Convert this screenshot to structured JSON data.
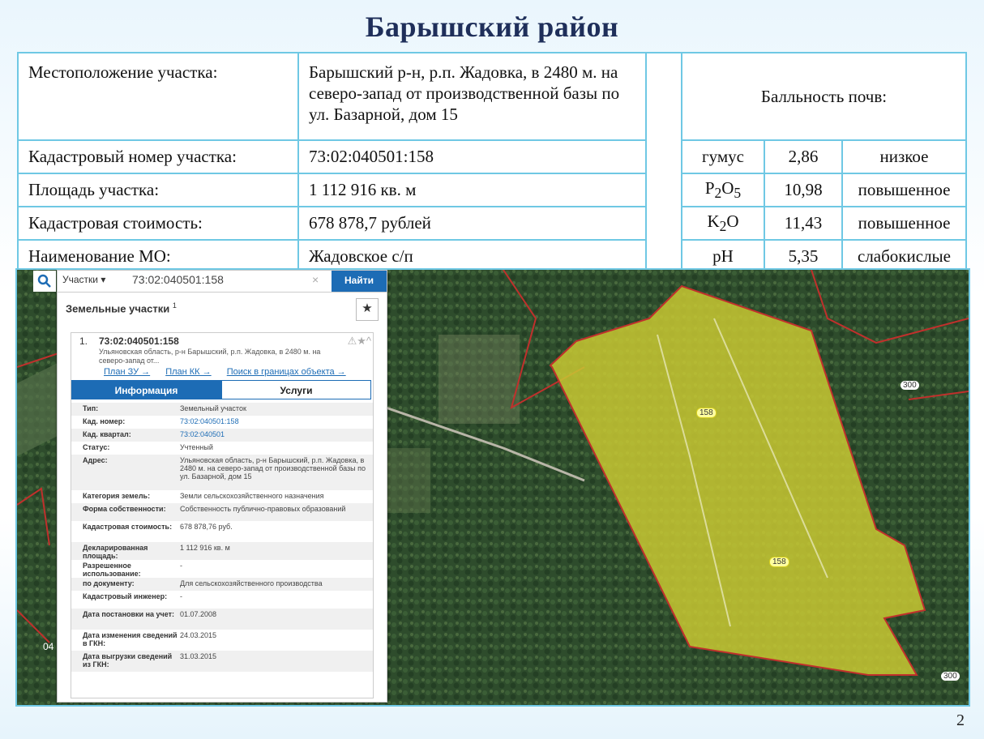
{
  "slide": {
    "title": "Барышский район",
    "page_number": "2"
  },
  "table": {
    "rows": [
      {
        "label": "Местоположение участка:",
        "value": "Барышский р-н, р.п. Жадовка, в 2480 м. на северо-запад от производственной базы по ул. Базарной, дом 15"
      },
      {
        "label": "Кадастровый номер участка:",
        "value": "73:02:040501:158"
      },
      {
        "label": "Площадь участка:",
        "value": "1 112 916 кв. м"
      },
      {
        "label": "Кадастровая стоимость:",
        "value": "678 878,7 рублей"
      },
      {
        "label": "Наименование МО:",
        "value": "Жадовское с/п"
      }
    ],
    "soil_header": "Балльность почв:",
    "soil": [
      {
        "name": "гумус",
        "value": "2,86",
        "level": "низкое"
      },
      {
        "name_main": "P",
        "sub1": "2",
        "mid": "O",
        "sub2": "5",
        "value": "10,98",
        "level": "повышенное"
      },
      {
        "name_main": "K",
        "sub1": "2",
        "mid": "O",
        "value": "11,43",
        "level": "повышенное"
      },
      {
        "name": "pH",
        "value": "5,35",
        "level": "слабокислые"
      }
    ]
  },
  "map": {
    "search": {
      "category": "Участки ▾",
      "query": "73:02:040501:158",
      "clear": "×",
      "button": "Найти"
    },
    "panel_title": "Земельные участки",
    "panel_count": "1",
    "star": "★",
    "result": {
      "index": "1.",
      "cad_number": "73:02:040501:158",
      "address_short": "Ульяновская область, р-н Барышский, р.п. Жадовка, в 2480 м. на северо-запад от...",
      "icons": "⚠★^",
      "links": [
        "План ЗУ →",
        "План КК →",
        "Поиск в границах объекта →"
      ],
      "tabs": [
        "Информация",
        "Услуги"
      ]
    },
    "details": [
      {
        "k": "Тип:",
        "v": "Земельный участок"
      },
      {
        "k": "Кад. номер:",
        "v": "73:02:040501:158",
        "link": true
      },
      {
        "k": "Кад. квартал:",
        "v": "73:02:040501",
        "link": true
      },
      {
        "k": "Статус:",
        "v": "Учтенный"
      },
      {
        "k": "Адрес:",
        "v": "Ульяновская область, р-н Барышский, р.п. Жадовка, в 2480 м. на северо-запад от производственной базы по ул. Базарной, дом 15"
      },
      {
        "k": "Категория земель:",
        "v": "Земли сельскохозяйственного назначения"
      },
      {
        "k": "Форма собственности:",
        "v": "Собственность публично-правовых образований"
      },
      {
        "k": "Кадастровая стоимость:",
        "v": "678 878,76 руб."
      },
      {
        "k": "Декларированная площадь:",
        "v": "1 112 916 кв. м"
      },
      {
        "k": "Разрешенное использование:",
        "v": "-"
      },
      {
        "k": "по документу:",
        "v": "Для сельскохозяйственного производства"
      },
      {
        "k": "Кадастровый инженер:",
        "v": "-"
      },
      {
        "k": "Дата постановки на учет:",
        "v": "01.07.2008"
      },
      {
        "k": "Дата изменения сведений в ГКН:",
        "v": "24.03.2015"
      },
      {
        "k": "Дата выгрузки сведений из ГКН:",
        "v": "31.03.2015"
      }
    ],
    "parcel_labels": [
      "158",
      "158"
    ],
    "tags": [
      "300",
      "300"
    ],
    "edge_label": "04",
    "colors": {
      "parcel_fill": "#c8c832",
      "boundary": "#c0302c",
      "accent": "#1d6cb5"
    }
  }
}
